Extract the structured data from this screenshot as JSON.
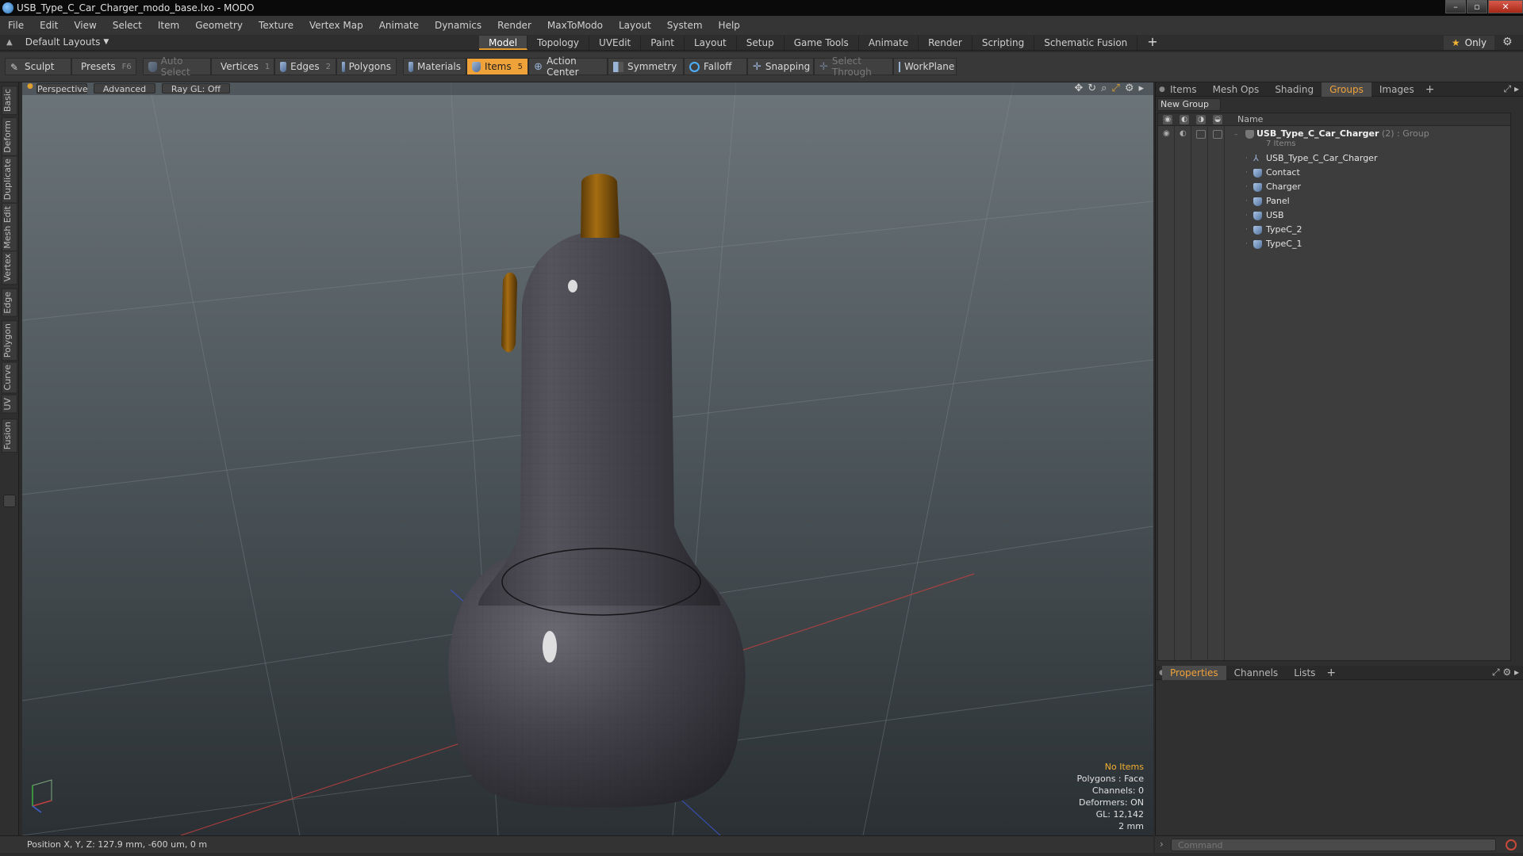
{
  "window": {
    "title": "USB_Type_C_Car_Charger_modo_base.lxo - MODO",
    "controls": [
      "–",
      "▫",
      "✕"
    ]
  },
  "menubar": [
    "File",
    "Edit",
    "View",
    "Select",
    "Item",
    "Geometry",
    "Texture",
    "Vertex Map",
    "Animate",
    "Dynamics",
    "Render",
    "MaxToModo",
    "Layout",
    "System",
    "Help"
  ],
  "layoutbar": {
    "layout_select": "Default Layouts",
    "tabs": [
      "Model",
      "Topology",
      "UVEdit",
      "Paint",
      "Layout",
      "Setup",
      "Game Tools",
      "Animate",
      "Render",
      "Scripting",
      "Schematic Fusion"
    ],
    "active_tab": "Model",
    "add_tab": "+",
    "only_label": "Only"
  },
  "toolbar": {
    "sculpt": "Sculpt",
    "presets": "Presets",
    "presets_key": "F6",
    "auto_select": "Auto Select",
    "vertices": "Vertices",
    "vertices_key": "1",
    "edges": "Edges",
    "edges_key": "2",
    "polygons": "Polygons",
    "materials": "Materials",
    "items": "Items",
    "items_key": "5",
    "action_center": "Action Center",
    "symmetry": "Symmetry",
    "falloff": "Falloff",
    "snapping": "Snapping",
    "select_through": "Select Through",
    "workplane": "WorkPlane"
  },
  "left_tabs": [
    "Basic",
    "Deform",
    "Duplicate",
    "Mesh Edit",
    "Vertex",
    "Edge",
    "Polygon",
    "Curve",
    "UV",
    "Fusion"
  ],
  "viewport": {
    "view_mode": "Perspective",
    "shading": "Advanced",
    "raygl": "Ray GL: Off",
    "stats": {
      "selection": "No Items",
      "polygons": "Polygons : Face",
      "channels": "Channels: 0",
      "deformers": "Deformers: ON",
      "gl": "GL: 12,142",
      "grid": "2 mm"
    },
    "colors": {
      "body": "#3f3e44",
      "accent": "#8a5a10",
      "bg_top": "#6a7378",
      "bg_bottom": "#2c3236"
    }
  },
  "right_panel": {
    "tabs": [
      "Items",
      "Mesh Ops",
      "Shading",
      "Groups",
      "Images"
    ],
    "active_tab": "Groups",
    "new_group": "New Group",
    "column_name": "Name",
    "group": {
      "name": "USB_Type_C_Car_Charger",
      "count": "(2)",
      "type": ": Group",
      "subtitle": "7 Items"
    },
    "items": [
      "USB_Type_C_Car_Charger",
      "Contact",
      "Charger",
      "Panel",
      "USB",
      "TypeC_2",
      "TypeC_1"
    ],
    "bottom_tabs": [
      "Properties",
      "Channels",
      "Lists"
    ],
    "bottom_active": "Properties"
  },
  "statusbar": {
    "position": "Position X, Y, Z:  127.9 mm, -600 um, 0 m"
  },
  "command": {
    "placeholder": "Command"
  }
}
